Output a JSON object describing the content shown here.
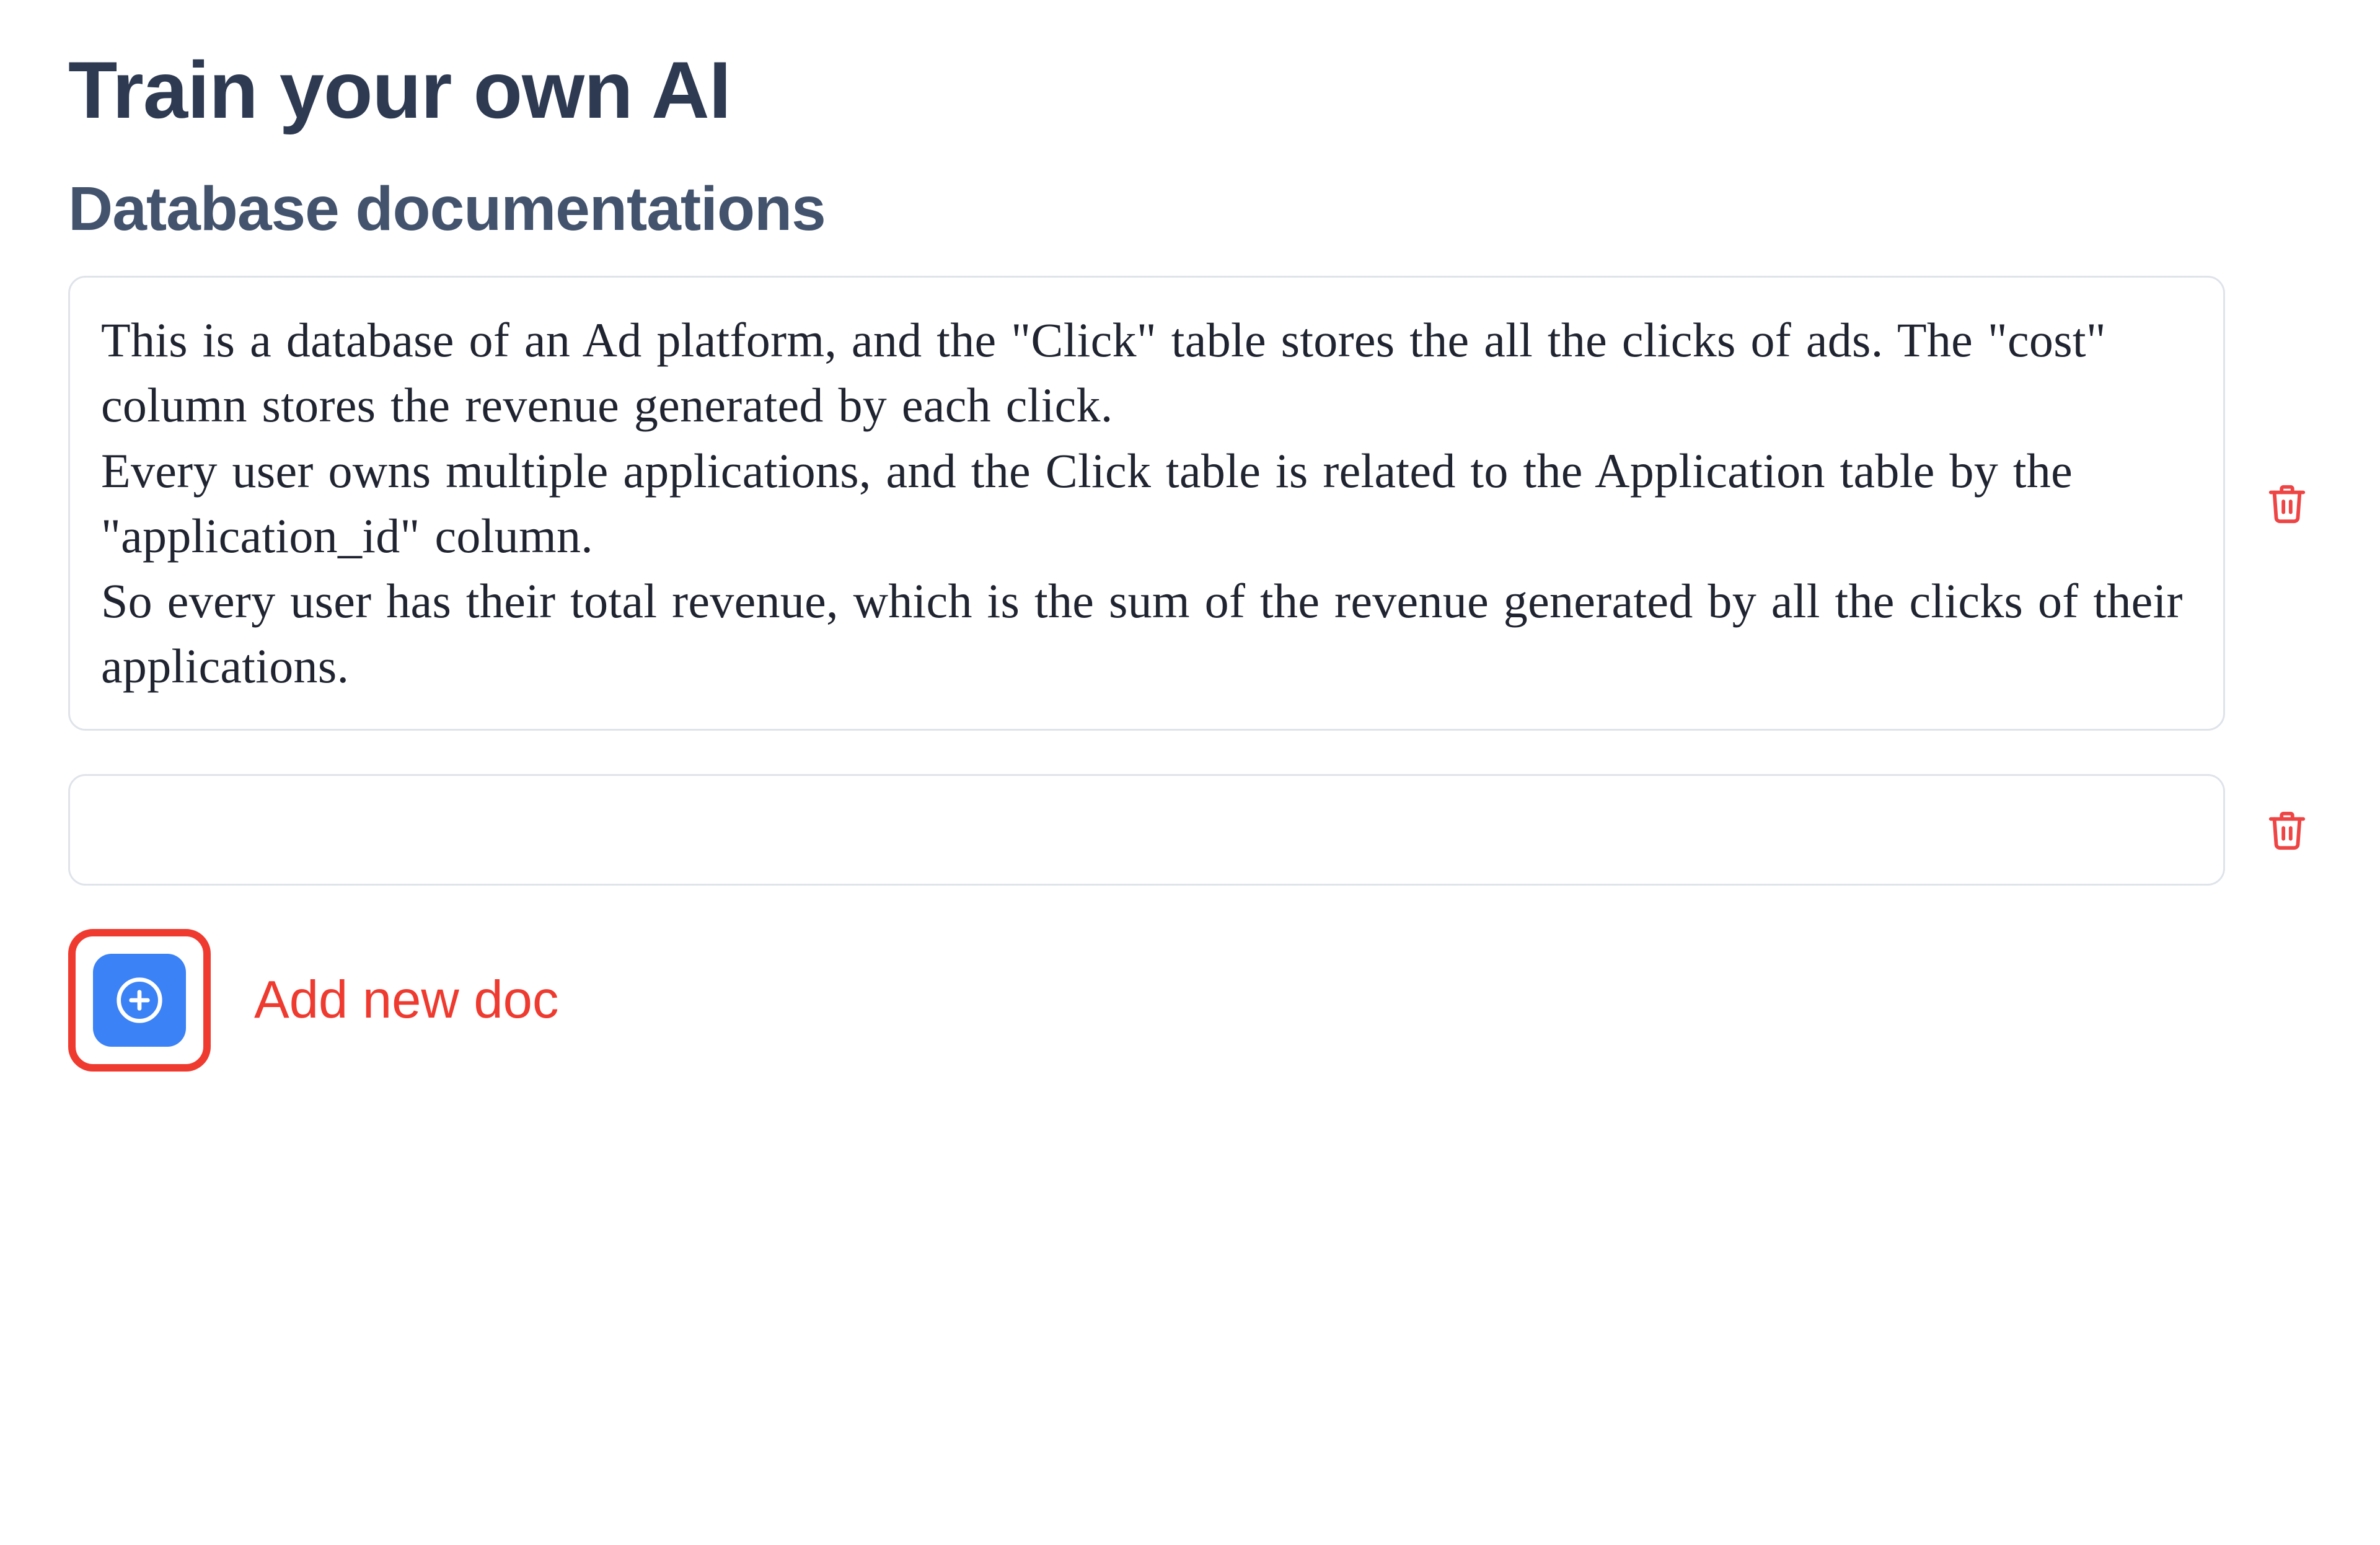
{
  "page": {
    "title": "Train your own AI"
  },
  "section": {
    "title": "Database documentations"
  },
  "docs": [
    {
      "text": "This is a database of an Ad platform, and the \"Click\" table stores the all the clicks of ads. The \"cost\" column stores the revenue generated by each click.\nEvery user owns multiple applications, and the Click table is related to the Application table by the \"application_id\" column.\nSo every user has their total revenue, which is the sum of the revenue generated by all the clicks of their applications."
    },
    {
      "text": ""
    }
  ],
  "actions": {
    "add_label": "Add new doc"
  },
  "icons": {
    "trash": "trash-icon",
    "plus_circle": "plus-circle-icon"
  },
  "colors": {
    "heading": "#2d3a52",
    "subheading": "#43536d",
    "body_text": "#1f2430",
    "border": "#dfe3ea",
    "danger": "#ef4444",
    "highlight": "#ef3a2f",
    "primary": "#3b82f6"
  }
}
